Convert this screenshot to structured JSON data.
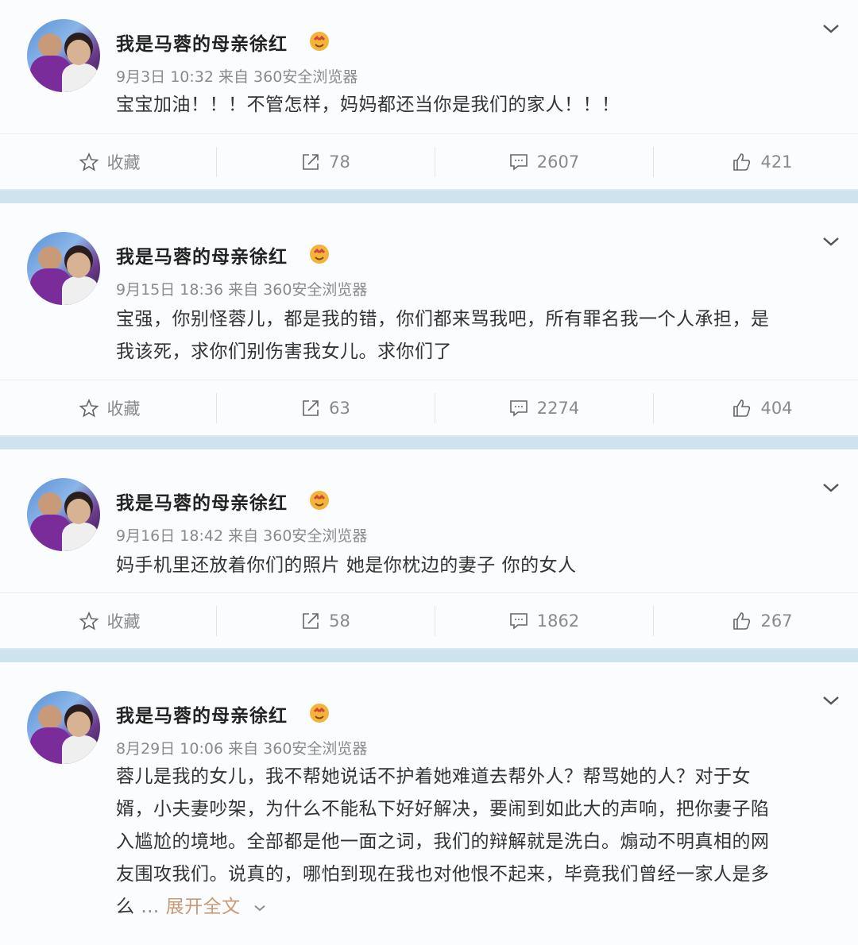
{
  "posts": [
    {
      "author": "我是马蓉的母亲徐红",
      "meta": "9月3日 10:32 来自 360安全浏览器",
      "text": "宝宝加油！！！不管怎样，妈妈都还当你是我们的家人！！！",
      "fav_label": "收藏",
      "shares": "78",
      "comments": "2607",
      "likes": "421"
    },
    {
      "author": "我是马蓉的母亲徐红",
      "meta": "9月15日 18:36 来自 360安全浏览器",
      "text_line1": "宝强，你别怪蓉儿，都是我的错，你们都来骂我吧，所有罪名我一个人承担，是",
      "text_line2": "我该死，求你们别伤害我女儿。求你们了",
      "fav_label": "收藏",
      "shares": "63",
      "comments": "2274",
      "likes": "404"
    },
    {
      "author": "我是马蓉的母亲徐红",
      "meta": "9月16日 18:42 来自 360安全浏览器",
      "text": "妈手机里还放着你们的照片 她是你枕边的妻子 你的女人",
      "fav_label": "收藏",
      "shares": "58",
      "comments": "1862",
      "likes": "267"
    },
    {
      "author": "我是马蓉的母亲徐红",
      "meta": "8月29日 10:06 来自 360安全浏览器",
      "text_line1": "蓉儿是我的女儿，我不帮她说话不护着她难道去帮外人？帮骂她的人？对于女",
      "text_line2": "婿，小夫妻吵架，为什么不能私下好好解决，要闹到如此大的声响，把你妻子陷",
      "text_line3": "入尴尬的境地。全部都是他一面之词，我们的辩解就是洗白。煽动不明真相的网",
      "text_line4": "友围攻我们。说真的，哪怕到现在我也对他恨不起来，毕竟我们曾经一家人是多",
      "text_line5": "么",
      "ellipsis": "...",
      "expand_label": "展开全文"
    }
  ],
  "colors": {
    "separator": "#cfe3ef",
    "expand": "#c99a73",
    "meta": "#8a8a8a"
  },
  "icons": [
    "star-icon",
    "share-icon",
    "comment-icon",
    "thumbs-up-icon",
    "chevron-down-icon",
    "love-badge-icon"
  ]
}
